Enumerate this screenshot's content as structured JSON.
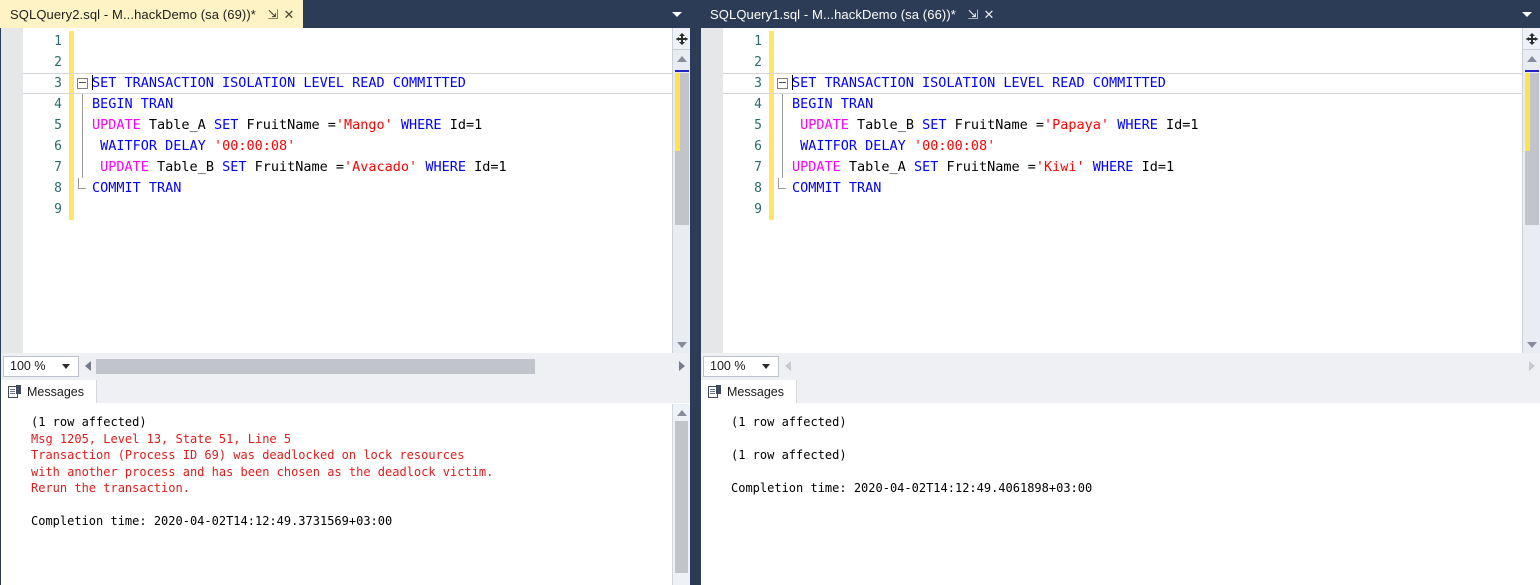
{
  "panes": [
    {
      "id": "left",
      "tab": {
        "title": "SQLQuery2.sql - M...hackDemo (sa (69))*",
        "active": true,
        "pin_icon": "pin-icon",
        "close_icon": "close-icon"
      },
      "overflow_icon": "chevron-down-icon",
      "code": {
        "lines": [
          {
            "n": "1",
            "tokens": []
          },
          {
            "n": "2",
            "tokens": []
          },
          {
            "n": "3",
            "current": true,
            "fold": "start",
            "tokens": [
              {
                "t": "SET TRANSACTION ISOLATION LEVEL READ COMMITTED",
                "c": "k"
              }
            ]
          },
          {
            "n": "4",
            "fold": "body",
            "tokens": [
              {
                "t": "BEGIN TRAN",
                "c": "k"
              }
            ]
          },
          {
            "n": "5",
            "fold": "body",
            "tokens": [
              {
                "t": "UPDATE",
                "c": "kw"
              },
              {
                "t": " Table_A ",
                "c": "id"
              },
              {
                "t": "SET",
                "c": "k"
              },
              {
                "t": " FruitName =",
                "c": "id"
              },
              {
                "t": "'Mango'",
                "c": "s"
              },
              {
                "t": " ",
                "c": "id"
              },
              {
                "t": "WHERE",
                "c": "k"
              },
              {
                "t": " Id=1",
                "c": "id"
              }
            ]
          },
          {
            "n": "6",
            "fold": "body",
            "tokens": [
              {
                "t": " ",
                "c": "id"
              },
              {
                "t": "WAITFOR DELAY",
                "c": "k"
              },
              {
                "t": " ",
                "c": "id"
              },
              {
                "t": "'00:00:08'",
                "c": "s"
              }
            ]
          },
          {
            "n": "7",
            "fold": "body",
            "tokens": [
              {
                "t": " ",
                "c": "id"
              },
              {
                "t": "UPDATE",
                "c": "kw"
              },
              {
                "t": " Table_B ",
                "c": "id"
              },
              {
                "t": "SET",
                "c": "k"
              },
              {
                "t": " FruitName =",
                "c": "id"
              },
              {
                "t": "'Avacado'",
                "c": "s"
              },
              {
                "t": " ",
                "c": "id"
              },
              {
                "t": "WHERE",
                "c": "k"
              },
              {
                "t": " Id=1",
                "c": "id"
              }
            ]
          },
          {
            "n": "8",
            "fold": "end",
            "tokens": [
              {
                "t": "COMMIT TRAN",
                "c": "k"
              }
            ]
          },
          {
            "n": "9",
            "tokens": []
          }
        ]
      },
      "zoom": {
        "value": "100 %",
        "chevron_icon": "chevron-down-icon"
      },
      "hscroll": {
        "left_arrow_dim": false,
        "right_arrow_dim": false,
        "thumb_pct": 76
      },
      "results_tab": {
        "label": "Messages",
        "icon": "messages-icon"
      },
      "messages": [
        {
          "text": "(1 row affected)",
          "color": "black"
        },
        {
          "text": "Msg 1205, Level 13, State 51, Line 5",
          "color": "red"
        },
        {
          "text": "Transaction (Process ID 69) was deadlocked on lock resources",
          "color": "red"
        },
        {
          "text": "with another process and has been chosen as the deadlock victim.",
          "color": "red"
        },
        {
          "text": "Rerun the transaction.",
          "color": "red"
        },
        {
          "text": "",
          "color": "black"
        },
        {
          "text": "Completion time: 2020-04-02T14:12:49.3731569+03:00",
          "color": "black"
        }
      ]
    },
    {
      "id": "right",
      "tab": {
        "title": "SQLQuery1.sql - M...hackDemo (sa (66))*",
        "active": false,
        "pin_icon": "pin-icon",
        "close_icon": "close-icon"
      },
      "overflow_icon": "chevron-down-icon",
      "code": {
        "lines": [
          {
            "n": "1",
            "tokens": []
          },
          {
            "n": "2",
            "tokens": []
          },
          {
            "n": "3",
            "current": true,
            "fold": "start",
            "tokens": [
              {
                "t": "SET TRANSACTION ISOLATION LEVEL READ COMMITTED",
                "c": "k"
              }
            ]
          },
          {
            "n": "4",
            "fold": "body",
            "tokens": [
              {
                "t": "BEGIN TRAN",
                "c": "k"
              }
            ]
          },
          {
            "n": "5",
            "fold": "body",
            "tokens": [
              {
                "t": " ",
                "c": "id"
              },
              {
                "t": "UPDATE",
                "c": "kw"
              },
              {
                "t": " Table_B ",
                "c": "id"
              },
              {
                "t": "SET",
                "c": "k"
              },
              {
                "t": " FruitName =",
                "c": "id"
              },
              {
                "t": "'Papaya'",
                "c": "s"
              },
              {
                "t": " ",
                "c": "id"
              },
              {
                "t": "WHERE",
                "c": "k"
              },
              {
                "t": " Id=1",
                "c": "id"
              }
            ]
          },
          {
            "n": "6",
            "fold": "body",
            "tokens": [
              {
                "t": " ",
                "c": "id"
              },
              {
                "t": "WAITFOR DELAY",
                "c": "k"
              },
              {
                "t": " ",
                "c": "id"
              },
              {
                "t": "'00:00:08'",
                "c": "s"
              }
            ]
          },
          {
            "n": "7",
            "fold": "body",
            "tokens": [
              {
                "t": "UPDATE",
                "c": "kw"
              },
              {
                "t": " Table_A ",
                "c": "id"
              },
              {
                "t": "SET",
                "c": "k"
              },
              {
                "t": " FruitName =",
                "c": "id"
              },
              {
                "t": "'Kiwi'",
                "c": "s"
              },
              {
                "t": " ",
                "c": "id"
              },
              {
                "t": "WHERE",
                "c": "k"
              },
              {
                "t": " Id=1",
                "c": "id"
              }
            ]
          },
          {
            "n": "8",
            "fold": "end",
            "tokens": [
              {
                "t": "COMMIT TRAN",
                "c": "k"
              }
            ]
          },
          {
            "n": "9",
            "tokens": []
          }
        ]
      },
      "zoom": {
        "value": "100 %",
        "chevron_icon": "chevron-down-icon"
      },
      "hscroll": {
        "left_arrow_dim": true,
        "right_arrow_dim": true,
        "thumb_pct": 0
      },
      "results_tab": {
        "label": "Messages",
        "icon": "messages-icon"
      },
      "messages": [
        {
          "text": "(1 row affected)",
          "color": "black"
        },
        {
          "text": "",
          "color": "black"
        },
        {
          "text": "(1 row affected)",
          "color": "black"
        },
        {
          "text": "",
          "color": "black"
        },
        {
          "text": "Completion time: 2020-04-02T14:12:49.4061898+03:00",
          "color": "black"
        }
      ]
    }
  ],
  "colors": {
    "tab_active_bg": "#fdf3c4",
    "chrome_bg": "#2d3c56",
    "keyword_blue": "#0000ff",
    "keyword_magenta": "#ff00ff",
    "string_red": "#ff0000",
    "error_red": "#e01b1b",
    "linenum_teal": "#2b6b6b",
    "changebar_yellow": "#ffe66b"
  }
}
